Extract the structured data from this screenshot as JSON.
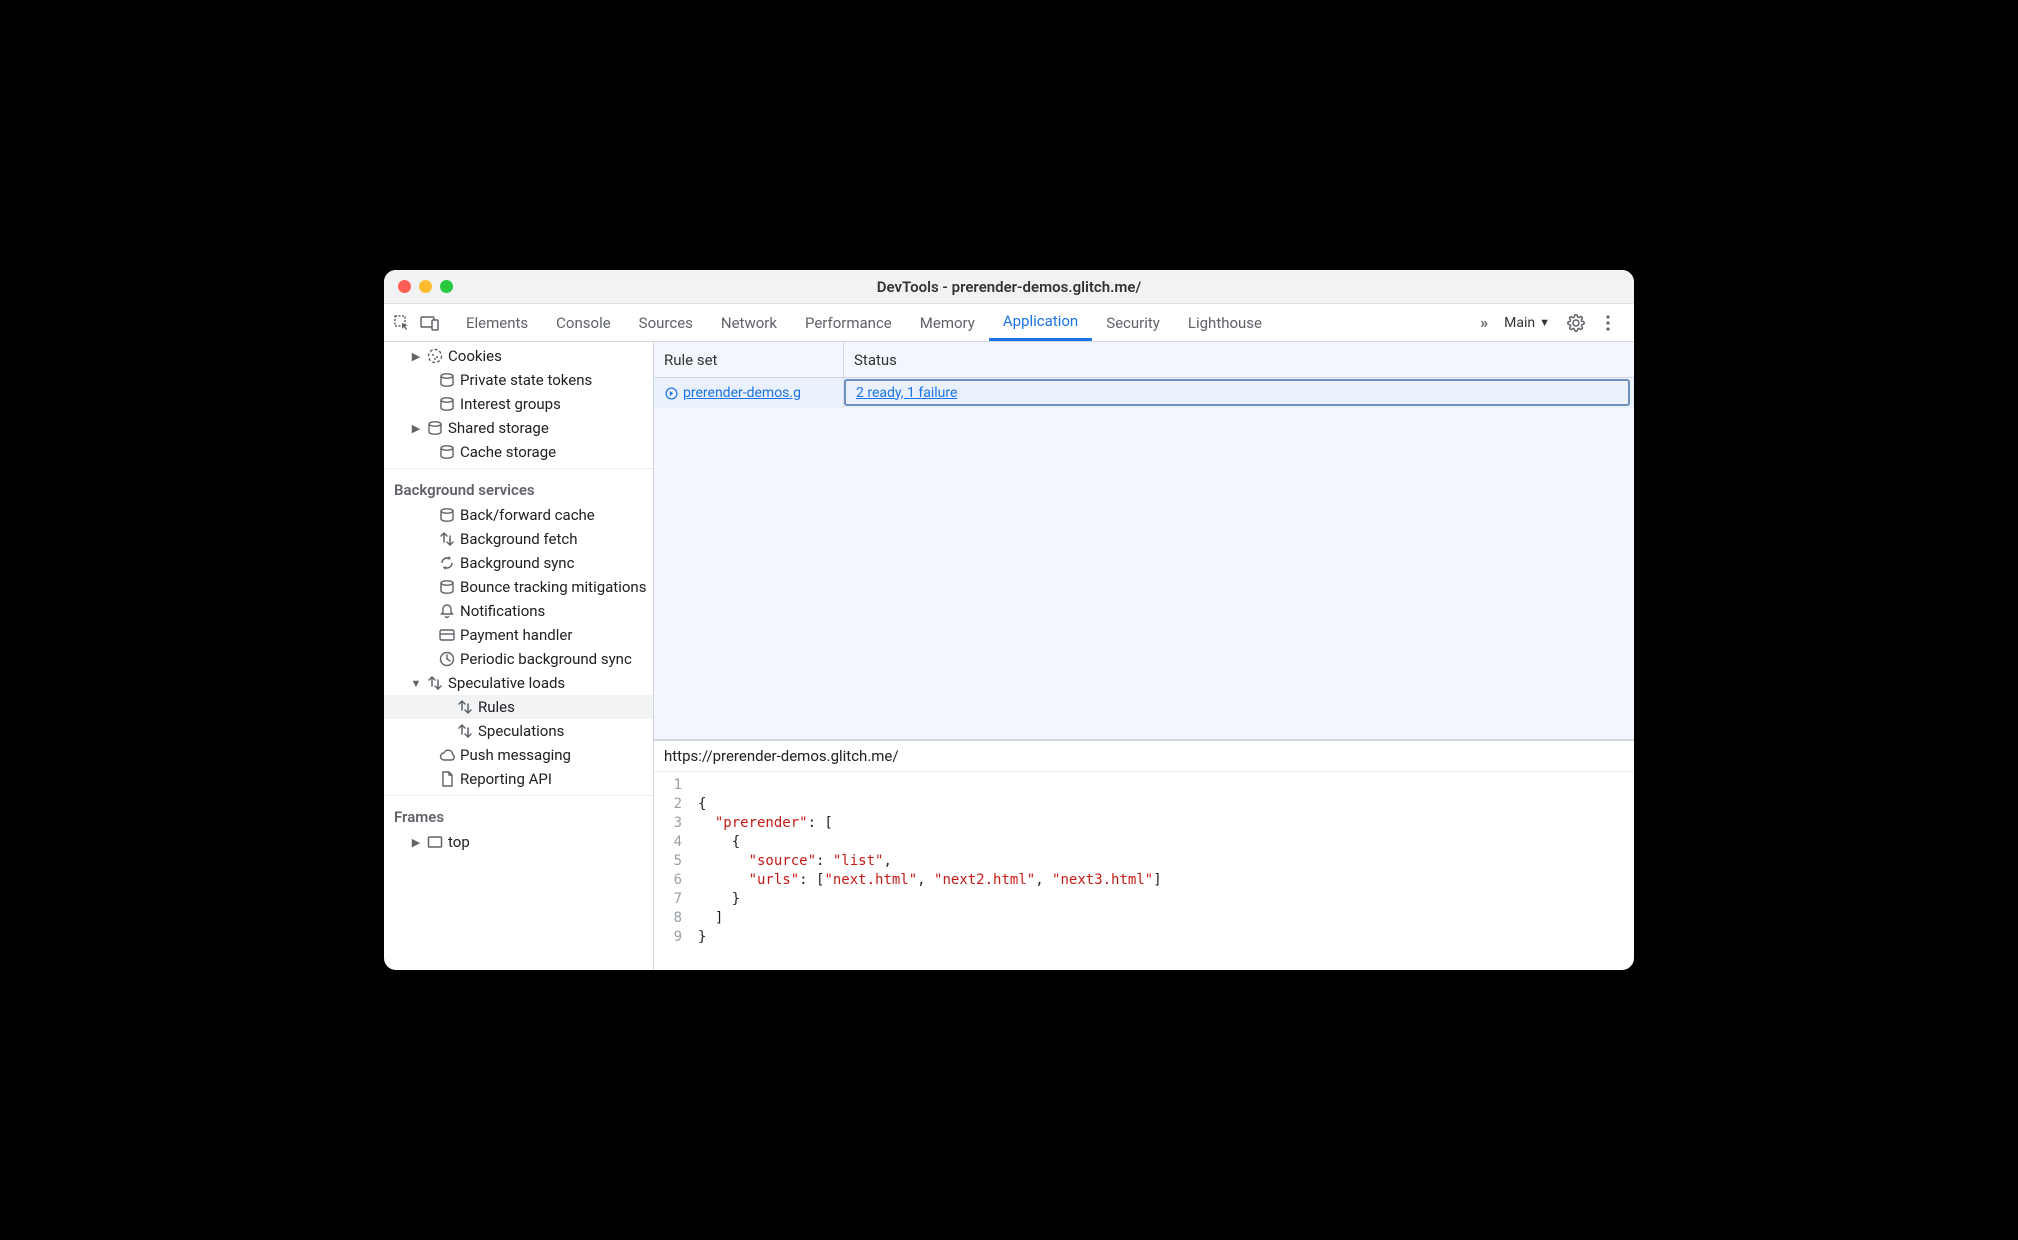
{
  "window": {
    "title": "DevTools - prerender-demos.glitch.me/"
  },
  "toolbar": {
    "tabs": [
      "Elements",
      "Console",
      "Sources",
      "Network",
      "Performance",
      "Memory",
      "Application",
      "Security",
      "Lighthouse"
    ],
    "activeTab": "Application",
    "targetLabel": "Main"
  },
  "sidebar": {
    "storageItems": [
      {
        "label": "Cookies",
        "icon": "cookie",
        "chev": "right",
        "indent": 16
      },
      {
        "label": "Private state tokens",
        "icon": "db",
        "chev": "",
        "indent": 28
      },
      {
        "label": "Interest groups",
        "icon": "db",
        "chev": "",
        "indent": 28
      },
      {
        "label": "Shared storage",
        "icon": "db",
        "chev": "right",
        "indent": 16
      },
      {
        "label": "Cache storage",
        "icon": "db",
        "chev": "",
        "indent": 28
      }
    ],
    "bgHeader": "Background services",
    "bgItems": [
      {
        "label": "Back/forward cache",
        "icon": "db",
        "chev": "",
        "indent": 28
      },
      {
        "label": "Background fetch",
        "icon": "updown",
        "chev": "",
        "indent": 28
      },
      {
        "label": "Background sync",
        "icon": "sync",
        "chev": "",
        "indent": 28
      },
      {
        "label": "Bounce tracking mitigations",
        "icon": "db",
        "chev": "",
        "indent": 28
      },
      {
        "label": "Notifications",
        "icon": "bell",
        "chev": "",
        "indent": 28
      },
      {
        "label": "Payment handler",
        "icon": "card",
        "chev": "",
        "indent": 28
      },
      {
        "label": "Periodic background sync",
        "icon": "clock",
        "chev": "",
        "indent": 28
      },
      {
        "label": "Speculative loads",
        "icon": "updown",
        "chev": "down",
        "indent": 16
      },
      {
        "label": "Rules",
        "icon": "updown",
        "chev": "",
        "indent": 46,
        "selected": true
      },
      {
        "label": "Speculations",
        "icon": "updown",
        "chev": "",
        "indent": 46
      },
      {
        "label": "Push messaging",
        "icon": "cloud",
        "chev": "",
        "indent": 28
      },
      {
        "label": "Reporting API",
        "icon": "doc",
        "chev": "",
        "indent": 28
      }
    ],
    "framesHeader": "Frames",
    "framesItems": [
      {
        "label": "top",
        "icon": "frame",
        "chev": "right",
        "indent": 16
      }
    ]
  },
  "grid": {
    "columns": {
      "ruleset": "Rule set",
      "status": "Status"
    },
    "rows": [
      {
        "ruleset": "prerender-demos.g",
        "status": "2 ready, 1 failure"
      }
    ]
  },
  "detail": {
    "url": "https://prerender-demos.glitch.me/",
    "code": {
      "lines": [
        [],
        [
          {
            "t": "punct",
            "v": "{"
          }
        ],
        [
          {
            "t": "pad",
            "v": "  "
          },
          {
            "t": "key",
            "v": "\"prerender\""
          },
          {
            "t": "punct",
            "v": ": ["
          }
        ],
        [
          {
            "t": "pad",
            "v": "    "
          },
          {
            "t": "punct",
            "v": "{"
          }
        ],
        [
          {
            "t": "pad",
            "v": "      "
          },
          {
            "t": "key",
            "v": "\"source\""
          },
          {
            "t": "punct",
            "v": ": "
          },
          {
            "t": "string",
            "v": "\"list\""
          },
          {
            "t": "punct",
            "v": ","
          }
        ],
        [
          {
            "t": "pad",
            "v": "      "
          },
          {
            "t": "key",
            "v": "\"urls\""
          },
          {
            "t": "punct",
            "v": ": ["
          },
          {
            "t": "string",
            "v": "\"next.html\""
          },
          {
            "t": "punct",
            "v": ", "
          },
          {
            "t": "string",
            "v": "\"next2.html\""
          },
          {
            "t": "punct",
            "v": ", "
          },
          {
            "t": "string",
            "v": "\"next3.html\""
          },
          {
            "t": "punct",
            "v": "]"
          }
        ],
        [
          {
            "t": "pad",
            "v": "    "
          },
          {
            "t": "punct",
            "v": "}"
          }
        ],
        [
          {
            "t": "pad",
            "v": "  "
          },
          {
            "t": "punct",
            "v": "]"
          }
        ],
        [
          {
            "t": "punct",
            "v": "}"
          }
        ]
      ]
    }
  }
}
